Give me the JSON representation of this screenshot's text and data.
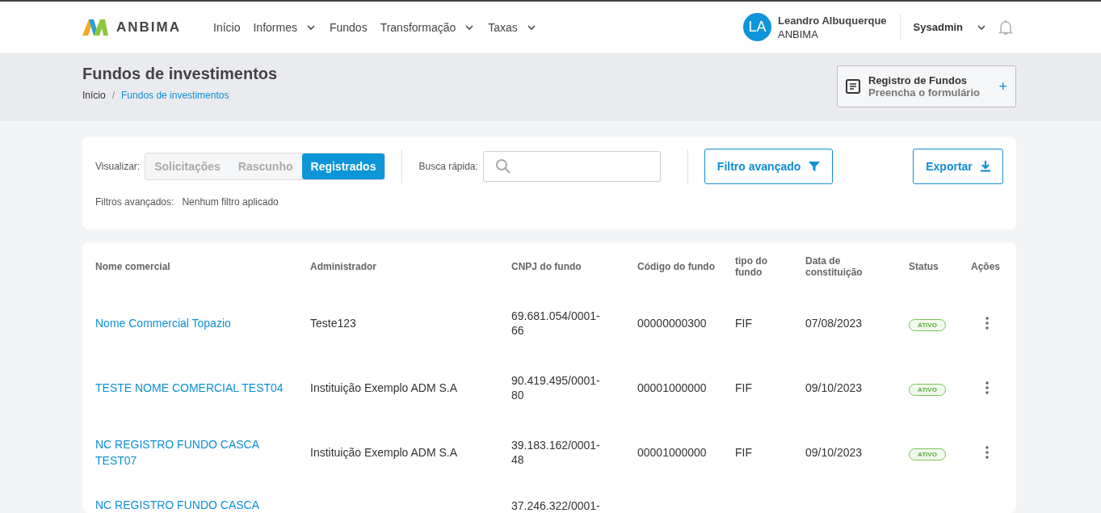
{
  "header": {
    "brand": "ANBIMA",
    "nav": [
      {
        "label": "Início",
        "dropdown": false
      },
      {
        "label": "Informes",
        "dropdown": true
      },
      {
        "label": "Fundos",
        "dropdown": false
      },
      {
        "label": "Transformação",
        "dropdown": true
      },
      {
        "label": "Taxas",
        "dropdown": true
      }
    ],
    "user": {
      "initials": "LA",
      "name": "Leandro Albuquerque",
      "org": "ANBIMA"
    },
    "role": "Sysadmin"
  },
  "page": {
    "title": "Fundos de investimentos",
    "breadcrumb_separator": "/",
    "breadcrumb": [
      {
        "label": "Início",
        "current": false
      },
      {
        "label": "Fundos de investimentos",
        "current": true
      }
    ],
    "register_card": {
      "title": "Registro de Fundos",
      "subtitle": "Preencha o formulário",
      "action": "+"
    }
  },
  "filters": {
    "view_label": "Visualizar:",
    "view_options": [
      {
        "label": "Solicitações",
        "selected": false
      },
      {
        "label": "Rascunho",
        "selected": false
      },
      {
        "label": "Registrados",
        "selected": true
      }
    ],
    "search_label": "Busca rápida:",
    "advanced_button": "Filtro avançado",
    "export_button": "Exportar",
    "applied_label": "Filtros avançados:",
    "applied_value": "Nenhum filtro aplicado"
  },
  "table": {
    "columns": [
      "Nome comercial",
      "Administrador",
      "CNPJ do fundo",
      "Código do fundo",
      "tipo do fundo",
      "Data de constituição",
      "Status",
      "Ações"
    ],
    "rows": [
      {
        "name": "Nome Commercial Topazio",
        "admin": "Teste123",
        "cnpj": "69.681.054/0001-66",
        "code": "00000000300",
        "type": "FIF",
        "date": "07/08/2023",
        "status": "ATIVO"
      },
      {
        "name": "TESTE NOME COMERCIAL TEST04",
        "admin": "Instituição Exemplo ADM S.A",
        "cnpj": "90.419.495/0001-80",
        "code": "00001000000",
        "type": "FIF",
        "date": "09/10/2023",
        "status": "ATIVO"
      },
      {
        "name": "NC REGISTRO FUNDO CASCA TEST07",
        "admin": "Instituição Exemplo ADM S.A",
        "cnpj": "39.183.162/0001-48",
        "code": "00001000000",
        "type": "FIF",
        "date": "09/10/2023",
        "status": "ATIVO"
      },
      {
        "name": "NC REGISTRO FUNDO CASCA",
        "cnpj": "37.246.322/0001-"
      }
    ]
  }
}
